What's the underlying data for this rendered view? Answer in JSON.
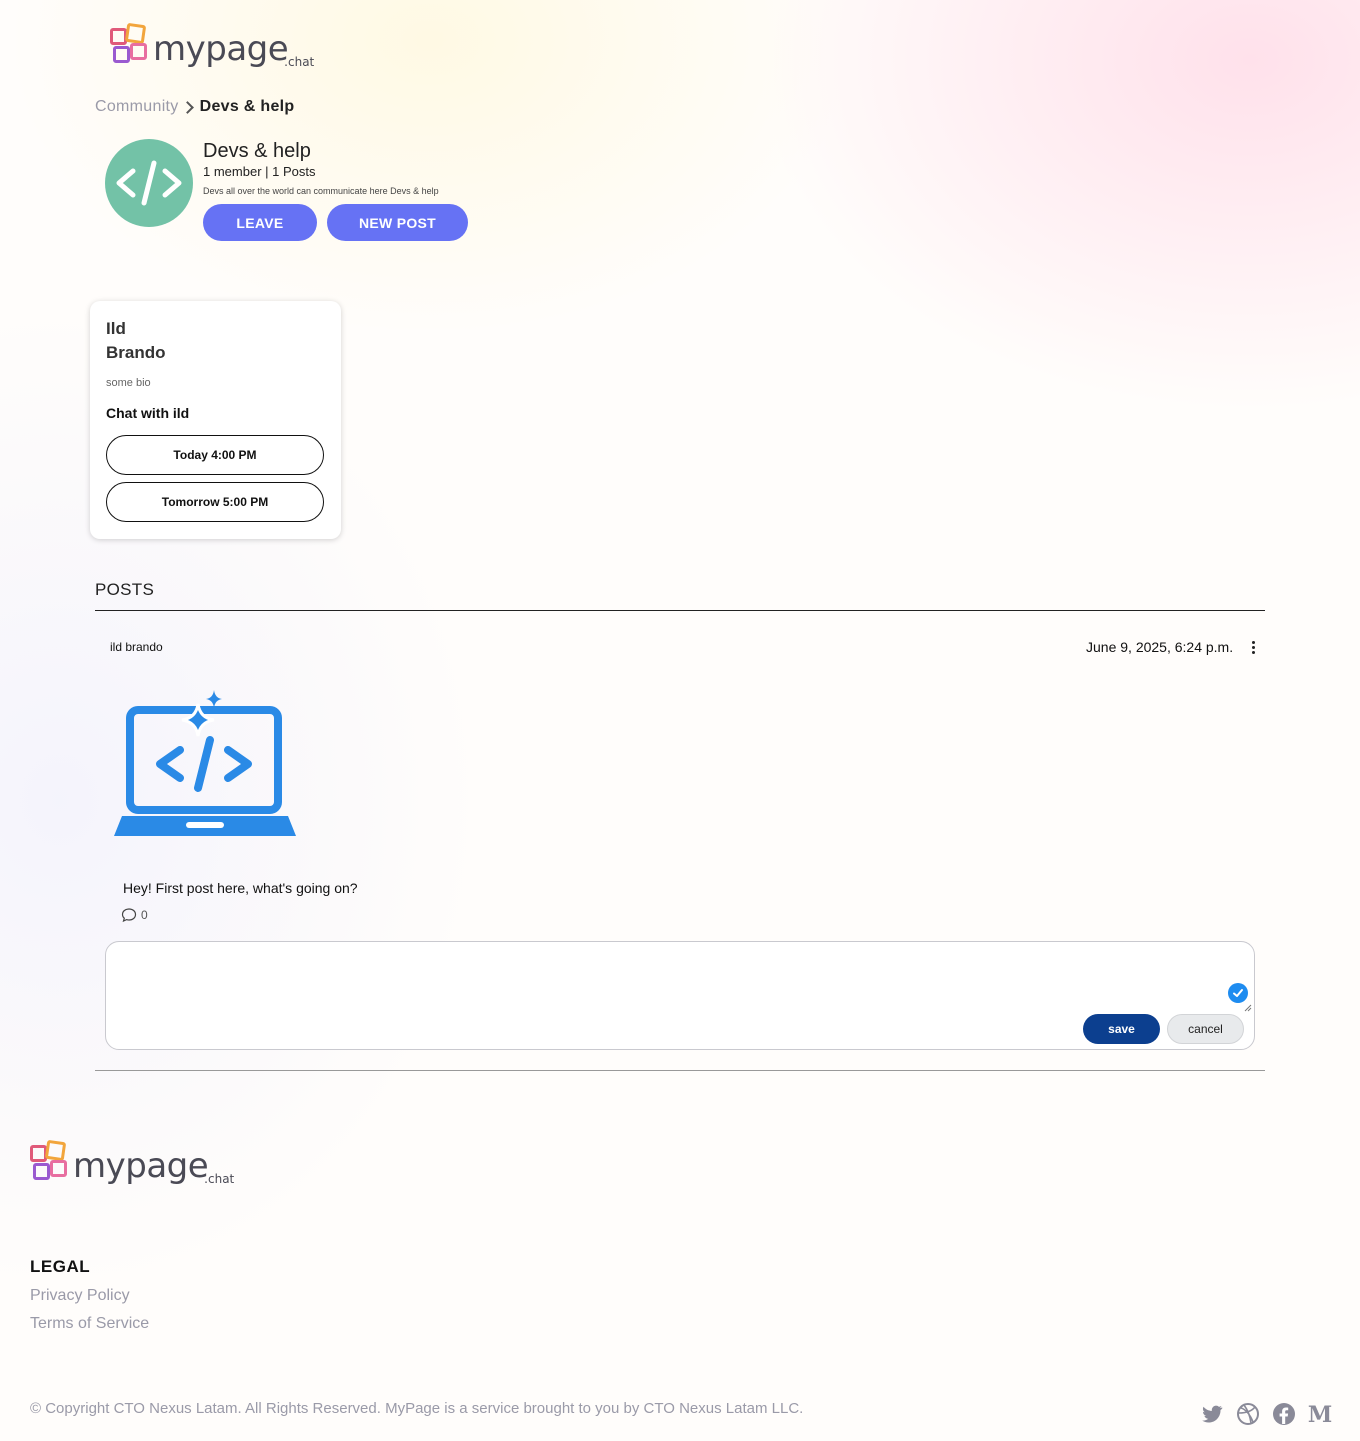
{
  "header": {
    "logo": {
      "word": "mypage",
      "sub": ".chat"
    }
  },
  "breadcrumb": {
    "parent": "Community",
    "current": "Devs & help"
  },
  "group": {
    "title": "Devs & help",
    "meta": "1 member | 1 Posts",
    "description": "Devs all over the world can communicate here Devs & help",
    "leave_label": "LEAVE",
    "new_post_label": "NEW POST",
    "avatar_icon": "code-icon",
    "avatar_color": "#73c2a7"
  },
  "member_card": {
    "first_name": "Ild",
    "last_name": "Brando",
    "bio": "some bio",
    "chat_label": "Chat with ild",
    "slots": [
      "Today 4:00 PM",
      "Tomorrow 5:00 PM"
    ]
  },
  "posts": {
    "heading": "POSTS",
    "items": [
      {
        "author": "ild brando",
        "date": "June 9, 2025, 6:24 p.m.",
        "image_icon": "laptop-code-icon",
        "text": "Hey! First post here, what's going on?",
        "comment_count": "0"
      }
    ],
    "editor": {
      "save_label": "save",
      "cancel_label": "cancel"
    }
  },
  "footer": {
    "logo": {
      "word": "mypage",
      "sub": ".chat"
    },
    "legal_heading": "LEGAL",
    "links": [
      "Privacy Policy",
      "Terms of Service"
    ],
    "copyright": "© Copyright CTO Nexus Latam. All Rights Reserved. MyPage is a service brought to you by CTO Nexus Latam LLC.",
    "social_icons": [
      "twitter-icon",
      "dribbble-icon",
      "facebook-icon",
      "medium-icon"
    ]
  },
  "colors": {
    "accent": "#6672f4",
    "save_button": "#0c3f8f",
    "post_icon": "#2a8ae6"
  }
}
